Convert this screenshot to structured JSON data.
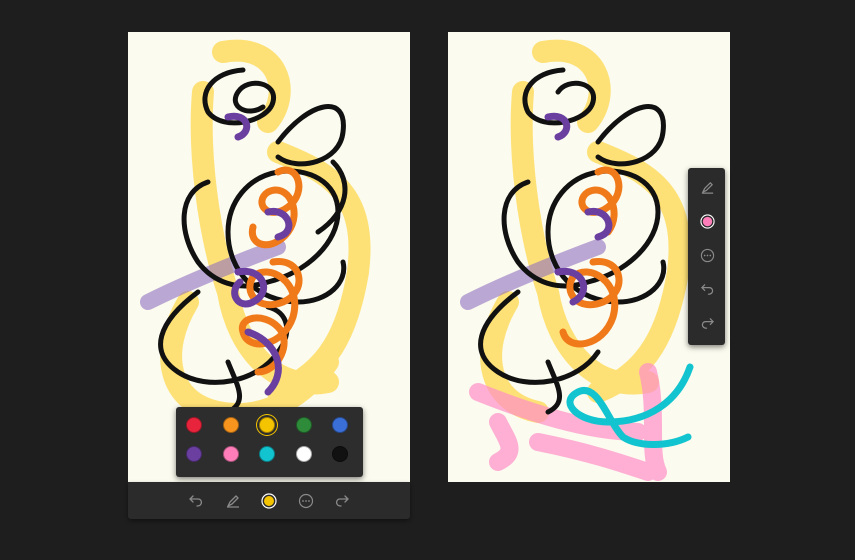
{
  "palette": {
    "colors": [
      {
        "name": "red",
        "hex": "#e8243c"
      },
      {
        "name": "orange",
        "hex": "#f7941d"
      },
      {
        "name": "yellow",
        "hex": "#f5c400"
      },
      {
        "name": "green",
        "hex": "#2e8b3a"
      },
      {
        "name": "blue",
        "hex": "#3b6fd8"
      },
      {
        "name": "purple",
        "hex": "#6a3fa0"
      },
      {
        "name": "pink",
        "hex": "#ff7eb9"
      },
      {
        "name": "cyan",
        "hex": "#12c4cf"
      },
      {
        "name": "white",
        "hex": "#ffffff"
      },
      {
        "name": "black",
        "hex": "#111111"
      }
    ],
    "selected": "yellow"
  },
  "bottom_toolbar": {
    "buttons": [
      "undo-icon",
      "highlighter-icon",
      "color-picker",
      "more-icon",
      "redo-icon"
    ],
    "current_color": "#f5c400"
  },
  "side_toolbar": {
    "buttons": [
      "highlighter-icon",
      "color-picker",
      "more-icon",
      "undo-icon",
      "redo-icon"
    ],
    "current_color": "#ff7eb9"
  },
  "ink_colors": {
    "highlight_yellow": "#ffd84d",
    "highlight_purple": "#8f6fbf",
    "highlight_pink": "#ff8fc8",
    "pen_black": "#111111",
    "pen_orange": "#f07a1a",
    "pen_purple": "#6a3fa0",
    "pen_cyan": "#12c4cf",
    "canvas": "#fbfbef",
    "toolbar": "#2b2b2b",
    "icon": "#8a8a8a"
  }
}
